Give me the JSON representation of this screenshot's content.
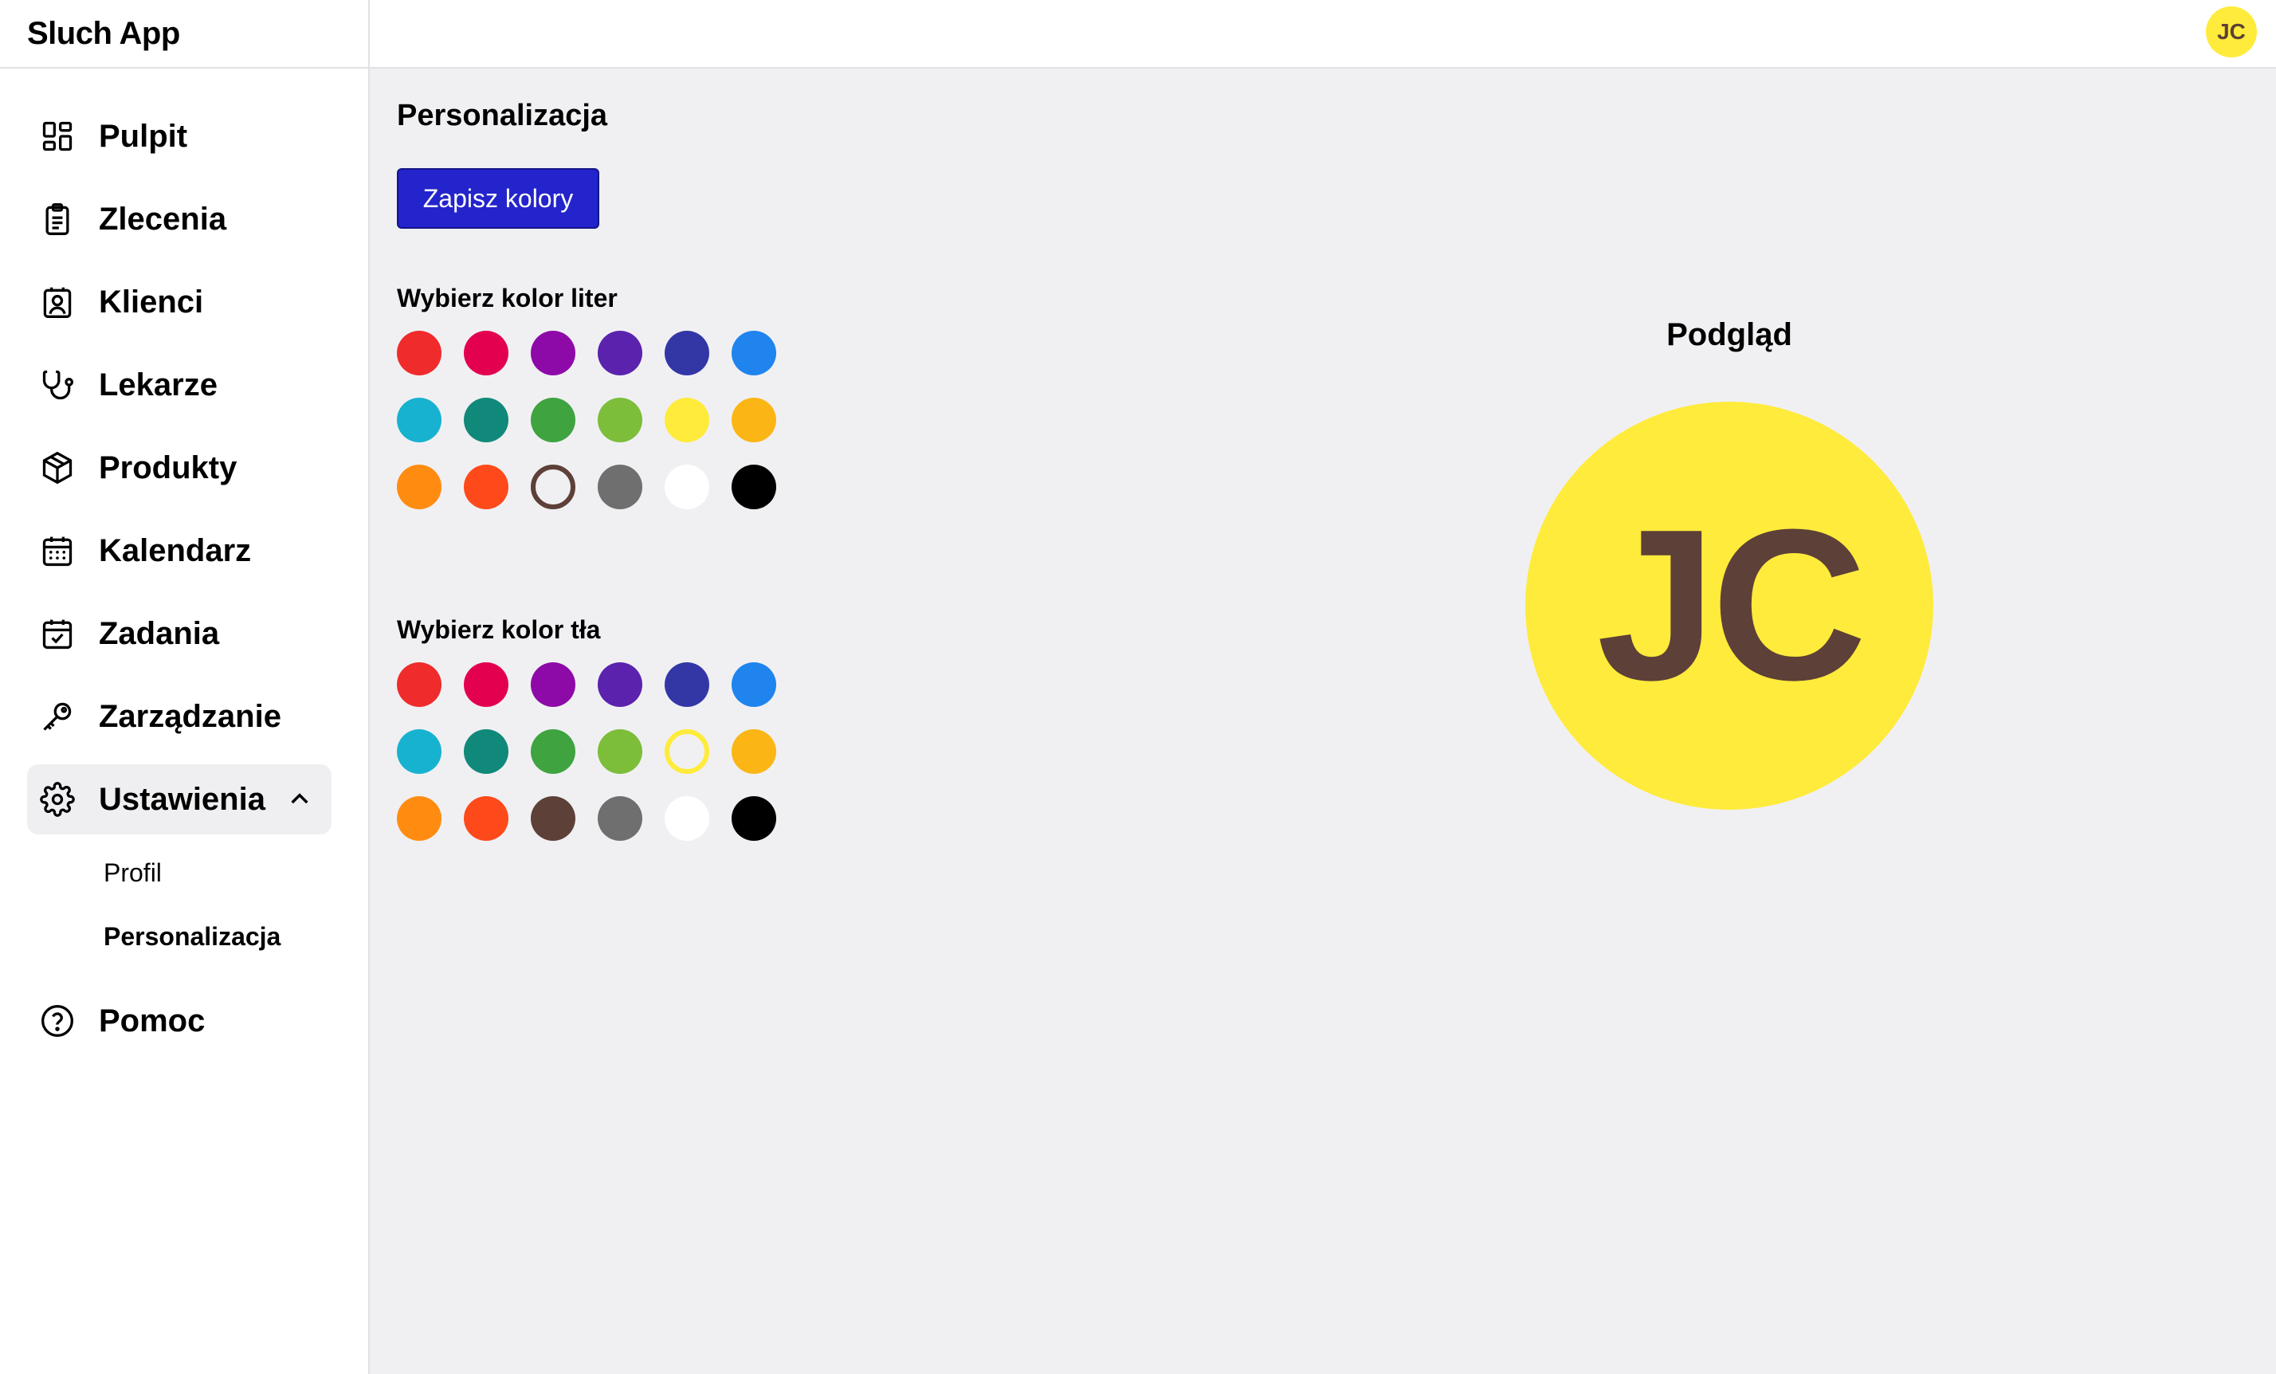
{
  "app": {
    "title": "Sluch App"
  },
  "user": {
    "initials": "JC"
  },
  "colors": {
    "accent": "#2424cc",
    "selected_text": "#5d4037",
    "selected_bg": "#ffeb3b"
  },
  "sidebar": {
    "items": [
      {
        "label": "Pulpit",
        "icon": "dashboard-icon"
      },
      {
        "label": "Zlecenia",
        "icon": "clipboard-icon"
      },
      {
        "label": "Klienci",
        "icon": "contact-icon"
      },
      {
        "label": "Lekarze",
        "icon": "stethoscope-icon"
      },
      {
        "label": "Produkty",
        "icon": "package-icon"
      },
      {
        "label": "Kalendarz",
        "icon": "calendar-icon"
      },
      {
        "label": "Zadania",
        "icon": "calendar-check-icon"
      },
      {
        "label": "Zarządzanie",
        "icon": "key-icon"
      },
      {
        "label": "Ustawienia",
        "icon": "gear-icon",
        "expanded": true
      },
      {
        "label": "Pomoc",
        "icon": "help-icon"
      }
    ],
    "settings_sub": [
      {
        "label": "Profil",
        "active": false
      },
      {
        "label": "Personalizacja",
        "active": true
      }
    ]
  },
  "main": {
    "title": "Personalizacja",
    "save_label": "Zapisz kolory",
    "text_color_label": "Wybierz kolor liter",
    "bg_color_label": "Wybierz kolor tła",
    "palette": [
      "#f02b2b",
      "#e3004f",
      "#8e0aa8",
      "#5b23ad",
      "#3337a6",
      "#1f84ee",
      "#17b2d0",
      "#11897a",
      "#3fa340",
      "#7cbd3a",
      "#ffeb3b",
      "#fbb615",
      "#ff8c11",
      "#fe4a1a",
      "#5d4037",
      "#6f6f6f",
      "#ffffff",
      "#000000"
    ],
    "text_color_selected_index": 14,
    "bg_color_selected_index": 10
  },
  "preview": {
    "title": "Podgląd"
  }
}
